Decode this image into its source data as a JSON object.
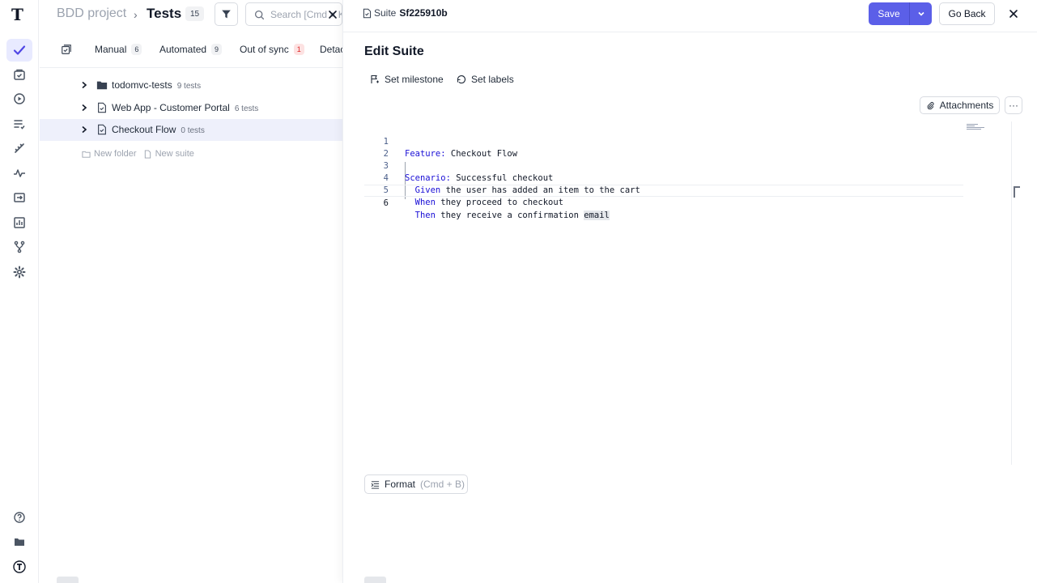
{
  "breadcrumb": {
    "project": "BDD project",
    "separator": "›",
    "page": "Tests",
    "count": "15"
  },
  "search": {
    "placeholder": "Search [Cmd + K]",
    "value": ""
  },
  "tabs": [
    {
      "label": "Manual",
      "count": "6"
    },
    {
      "label": "Automated",
      "count": "9"
    },
    {
      "label": "Out of sync",
      "count": "1"
    },
    {
      "label": "Detached",
      "count": ""
    }
  ],
  "tree": [
    {
      "label": "todomvc-tests",
      "count": "9 tests",
      "type": "folder-icon"
    },
    {
      "label": "Web App - Customer Portal",
      "count": "6 tests",
      "type": "suite-file-icon"
    },
    {
      "label": "Checkout Flow",
      "count": "0 tests",
      "type": "suite-file-icon"
    }
  ],
  "tree_actions": {
    "new_folder": "New folder",
    "new_suite": "New suite"
  },
  "panel": {
    "suite_prefix": "Suite",
    "suite_id": "Sf225910b",
    "save_label": "Save",
    "go_back_label": "Go Back",
    "title": "Edit Suite",
    "set_milestone": "Set milestone",
    "set_labels": "Set labels",
    "attachments": "Attachments",
    "more": "···",
    "format_label": "Format",
    "format_hint": "(Cmd + B)"
  },
  "editor": {
    "lines": [
      {
        "num": "1",
        "kw": "Feature:",
        "rest": " Checkout Flow"
      },
      {
        "num": "2",
        "kw": "",
        "rest": ""
      },
      {
        "num": "3",
        "kw": "Scenario:",
        "rest": " Successful checkout"
      },
      {
        "num": "4",
        "kw": "  Given",
        "rest": " the user has added an item to the cart"
      },
      {
        "num": "5",
        "kw": "  When",
        "rest": " they proceed to checkout"
      },
      {
        "num": "6",
        "kw": "  Then",
        "rest": " they receive a confirmation ",
        "highlight": "email"
      }
    ]
  },
  "colors": {
    "accent": "#5b5fe8",
    "keyword": "#1a0fd6",
    "selected_row": "#eef0fb"
  }
}
